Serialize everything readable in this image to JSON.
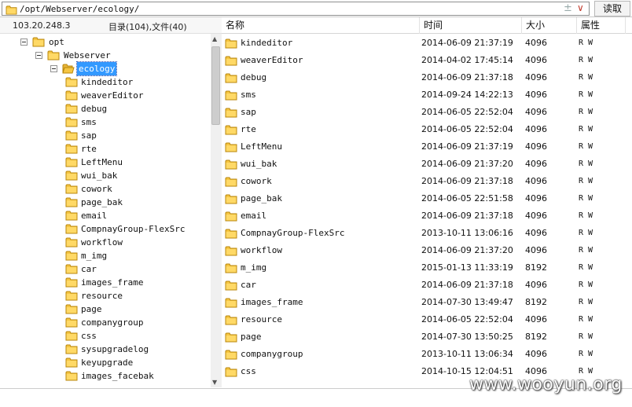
{
  "address": {
    "path": "/opt/Webserver/ecology/",
    "spin_glyph": "±",
    "dropdown_glyph": "∨"
  },
  "read_button": "读取",
  "info": {
    "ip": "103.20.248.3",
    "stats": "目录(104),文件(40)"
  },
  "columns": {
    "name": "名称",
    "time": "时间",
    "size": "大小",
    "attr": "属性"
  },
  "tree": [
    {
      "label": "opt",
      "level": 0,
      "expanded": true
    },
    {
      "label": "Webserver",
      "level": 1,
      "expanded": true
    },
    {
      "label": "ecology",
      "level": 2,
      "expanded": true,
      "selected": true,
      "open": true
    },
    {
      "label": "kindeditor",
      "level": 3
    },
    {
      "label": "weaverEditor",
      "level": 3
    },
    {
      "label": "debug",
      "level": 3
    },
    {
      "label": "sms",
      "level": 3
    },
    {
      "label": "sap",
      "level": 3
    },
    {
      "label": "rte",
      "level": 3
    },
    {
      "label": "LeftMenu",
      "level": 3
    },
    {
      "label": "wui_bak",
      "level": 3
    },
    {
      "label": "cowork",
      "level": 3
    },
    {
      "label": "page_bak",
      "level": 3
    },
    {
      "label": "email",
      "level": 3
    },
    {
      "label": "CompnayGroup-FlexSrc",
      "level": 3
    },
    {
      "label": "workflow",
      "level": 3
    },
    {
      "label": "m_img",
      "level": 3
    },
    {
      "label": "car",
      "level": 3
    },
    {
      "label": "images_frame",
      "level": 3
    },
    {
      "label": "resource",
      "level": 3
    },
    {
      "label": "page",
      "level": 3
    },
    {
      "label": "companygroup",
      "level": 3
    },
    {
      "label": "css",
      "level": 3
    },
    {
      "label": "sysupgradelog",
      "level": 3
    },
    {
      "label": "keyupgrade",
      "level": 3
    },
    {
      "label": "images_facebak",
      "level": 3
    }
  ],
  "files": [
    {
      "name": "kindeditor",
      "time": "2014-06-09 21:37:19",
      "size": "4096",
      "attr": "R W"
    },
    {
      "name": "weaverEditor",
      "time": "2014-04-02 17:45:14",
      "size": "4096",
      "attr": "R W"
    },
    {
      "name": "debug",
      "time": "2014-06-09 21:37:18",
      "size": "4096",
      "attr": "R W"
    },
    {
      "name": "sms",
      "time": "2014-09-24 14:22:13",
      "size": "4096",
      "attr": "R W"
    },
    {
      "name": "sap",
      "time": "2014-06-05 22:52:04",
      "size": "4096",
      "attr": "R W"
    },
    {
      "name": "rte",
      "time": "2014-06-05 22:52:04",
      "size": "4096",
      "attr": "R W"
    },
    {
      "name": "LeftMenu",
      "time": "2014-06-09 21:37:19",
      "size": "4096",
      "attr": "R W"
    },
    {
      "name": "wui_bak",
      "time": "2014-06-09 21:37:20",
      "size": "4096",
      "attr": "R W"
    },
    {
      "name": "cowork",
      "time": "2014-06-09 21:37:18",
      "size": "4096",
      "attr": "R W"
    },
    {
      "name": "page_bak",
      "time": "2014-06-05 22:51:58",
      "size": "4096",
      "attr": "R W"
    },
    {
      "name": "email",
      "time": "2014-06-09 21:37:18",
      "size": "4096",
      "attr": "R W"
    },
    {
      "name": "CompnayGroup-FlexSrc",
      "time": "2013-10-11 13:06:16",
      "size": "4096",
      "attr": "R W"
    },
    {
      "name": "workflow",
      "time": "2014-06-09 21:37:20",
      "size": "4096",
      "attr": "R W"
    },
    {
      "name": "m_img",
      "time": "2015-01-13 11:33:19",
      "size": "8192",
      "attr": "R W"
    },
    {
      "name": "car",
      "time": "2014-06-09 21:37:18",
      "size": "4096",
      "attr": "R W"
    },
    {
      "name": "images_frame",
      "time": "2014-07-30 13:49:47",
      "size": "8192",
      "attr": "R W"
    },
    {
      "name": "resource",
      "time": "2014-06-05 22:52:04",
      "size": "4096",
      "attr": "R W"
    },
    {
      "name": "page",
      "time": "2014-07-30 13:50:25",
      "size": "8192",
      "attr": "R W"
    },
    {
      "name": "companygroup",
      "time": "2013-10-11 13:06:34",
      "size": "4096",
      "attr": "R W"
    },
    {
      "name": "css",
      "time": "2014-10-15 12:04:51",
      "size": "4096",
      "attr": "R W"
    }
  ],
  "watermark": "www.wooyun.org"
}
